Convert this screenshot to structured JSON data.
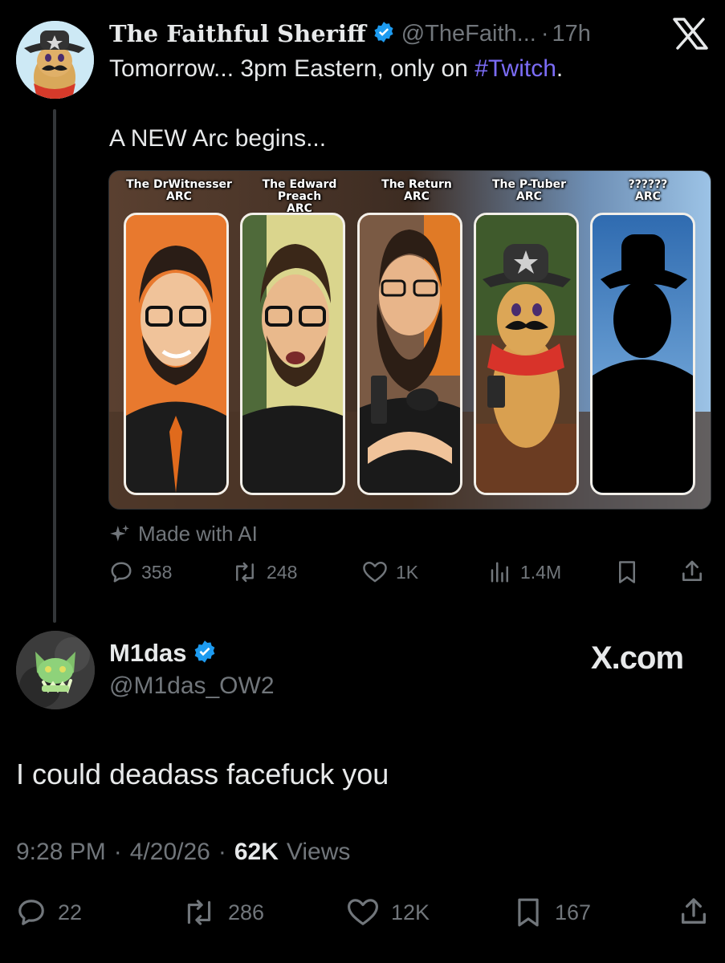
{
  "quoted_tweet": {
    "display_name": "The Faithful Sheriff",
    "handle": "@TheFaith...",
    "separator": "·",
    "time": "17h",
    "text_before_hashtag": "Tomorrow... 3pm Eastern, only on ",
    "hashtag": "#Twitch",
    "text_after_hashtag": ".",
    "text_line2": "A NEW Arc begins...",
    "media_cards": [
      {
        "title1": "The DrWitnesser",
        "title2": "ARC"
      },
      {
        "title1": "The Edward Preach",
        "title2": "ARC"
      },
      {
        "title1": "The Return",
        "title2": "ARC"
      },
      {
        "title1": "The P-Tuber",
        "title2": "ARC"
      },
      {
        "title1": "??????",
        "title2": "ARC"
      }
    ],
    "ai_label": "Made with AI",
    "stats": {
      "replies": "358",
      "reposts": "248",
      "likes": "1K",
      "views": "1.4M"
    }
  },
  "main_tweet": {
    "display_name": "M1das",
    "handle": "@M1das_OW2",
    "watermark": "X.com",
    "text": "I could deadass facefuck you",
    "time": "9:28 PM",
    "date": "4/20/26",
    "separator": "·",
    "views_count": "62K",
    "views_label": "Views",
    "stats": {
      "replies": "22",
      "reposts": "286",
      "likes": "12K",
      "bookmarks": "167"
    }
  },
  "colors": {
    "background": "#000000",
    "text": "#e7e9ea",
    "muted": "#71767b",
    "hashtag": "#7b6cf6",
    "verified": "#1d9bf0"
  },
  "icons": [
    "x-logo-icon",
    "verified-badge-icon",
    "sparkle-icon",
    "reply-icon",
    "repost-icon",
    "like-icon",
    "views-icon",
    "bookmark-icon",
    "share-icon"
  ]
}
